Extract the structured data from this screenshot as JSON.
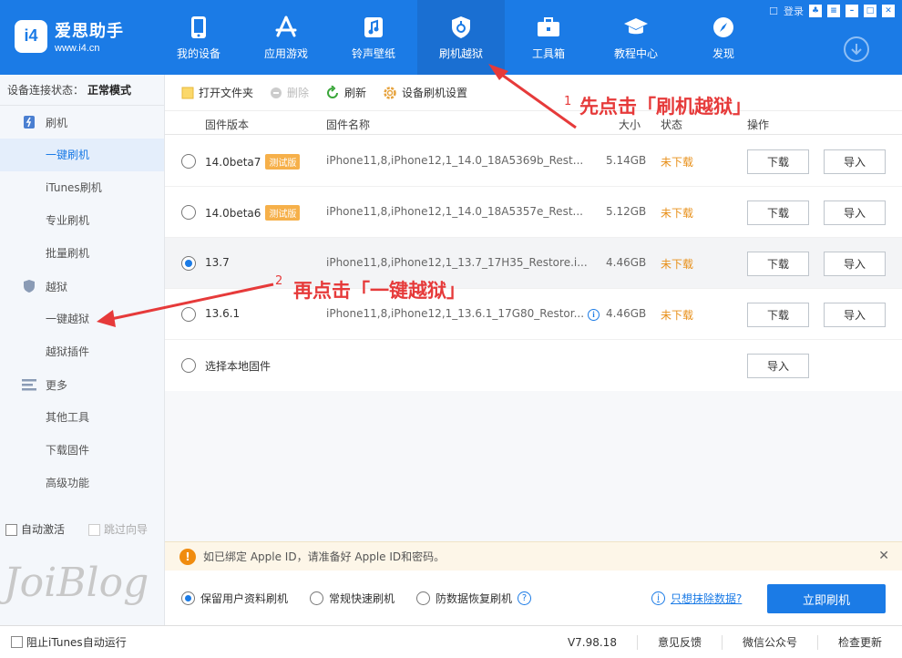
{
  "app": {
    "logo_badge": "i4",
    "name": "爱思助手",
    "url": "www.i4.cn",
    "login": "登录",
    "brand_color": "#1b7be6"
  },
  "nav": [
    {
      "label": "我的设备",
      "icon": "phone-icon"
    },
    {
      "label": "应用游戏",
      "icon": "app-store-icon"
    },
    {
      "label": "铃声壁纸",
      "icon": "music-icon"
    },
    {
      "label": "刷机越狱",
      "icon": "flash-icon",
      "active": true
    },
    {
      "label": "工具箱",
      "icon": "toolbox-icon"
    },
    {
      "label": "教程中心",
      "icon": "graduation-cap-icon"
    },
    {
      "label": "发现",
      "icon": "compass-icon"
    }
  ],
  "sidebar": {
    "status_label": "设备连接状态：",
    "status_value": "正常模式",
    "groups": [
      {
        "label": "刷机",
        "icon": "flash-device-icon",
        "items": [
          "一键刷机",
          "iTunes刷机",
          "专业刷机",
          "批量刷机"
        ]
      },
      {
        "label": "越狱",
        "icon": "shield-icon",
        "items": [
          "一键越狱",
          "越狱插件"
        ]
      },
      {
        "label": "更多",
        "icon": "menu-lines-icon",
        "items": [
          "其他工具",
          "下载固件",
          "高级功能"
        ]
      }
    ],
    "auto_activate": "自动激活",
    "skip_guide": "跳过向导",
    "watermark": "JoiBlog"
  },
  "toolbar": {
    "open_folder": "打开文件夹",
    "delete": "删除",
    "refresh": "刷新",
    "settings": "设备刷机设置"
  },
  "table": {
    "headers": {
      "version": "固件版本",
      "name": "固件名称",
      "size": "大小",
      "status": "状态",
      "ops": "操作"
    },
    "rows": [
      {
        "version": "14.0beta7",
        "beta": "测试版",
        "name": "iPhone11,8,iPhone12,1_14.0_18A5369b_Rest...",
        "size": "5.14GB",
        "status": "未下载",
        "download": "下载",
        "import": "导入"
      },
      {
        "version": "14.0beta6",
        "beta": "测试版",
        "name": "iPhone11,8,iPhone12,1_14.0_18A5357e_Rest...",
        "size": "5.12GB",
        "status": "未下载",
        "download": "下载",
        "import": "导入"
      },
      {
        "version": "13.7",
        "beta": "",
        "name": "iPhone11,8,iPhone12,1_13.7_17H35_Restore.i...",
        "size": "4.46GB",
        "status": "未下载",
        "download": "下载",
        "import": "导入"
      },
      {
        "version": "13.6.1",
        "beta": "",
        "name": "iPhone11,8,iPhone12,1_13.6.1_17G80_Restor...",
        "size": "4.46GB",
        "status": "未下载",
        "download": "下载",
        "import": "导入"
      }
    ],
    "local_label": "选择本地固件",
    "local_import": "导入"
  },
  "notice": {
    "icon": "!",
    "text": "如已绑定 Apple ID，请准备好 Apple ID和密码。"
  },
  "options": {
    "keep_data": "保留用户资料刷机",
    "quick": "常规快速刷机",
    "anti_recovery": "防数据恢复刷机",
    "help": "?",
    "info": "i",
    "wipe_link": "只想抹除数据?",
    "flash_now": "立即刷机"
  },
  "statusbar": {
    "block_itunes": "阻止iTunes自动运行",
    "version": "V7.98.18",
    "feedback": "意见反馈",
    "wechat": "微信公众号",
    "update": "检查更新"
  },
  "annotations": {
    "step1_num": "1",
    "step1_text": "先点击「刷机越狱」",
    "step2_num": "2",
    "step2_text": "再点击「一键越狱」",
    "color": "#e63a3a"
  }
}
